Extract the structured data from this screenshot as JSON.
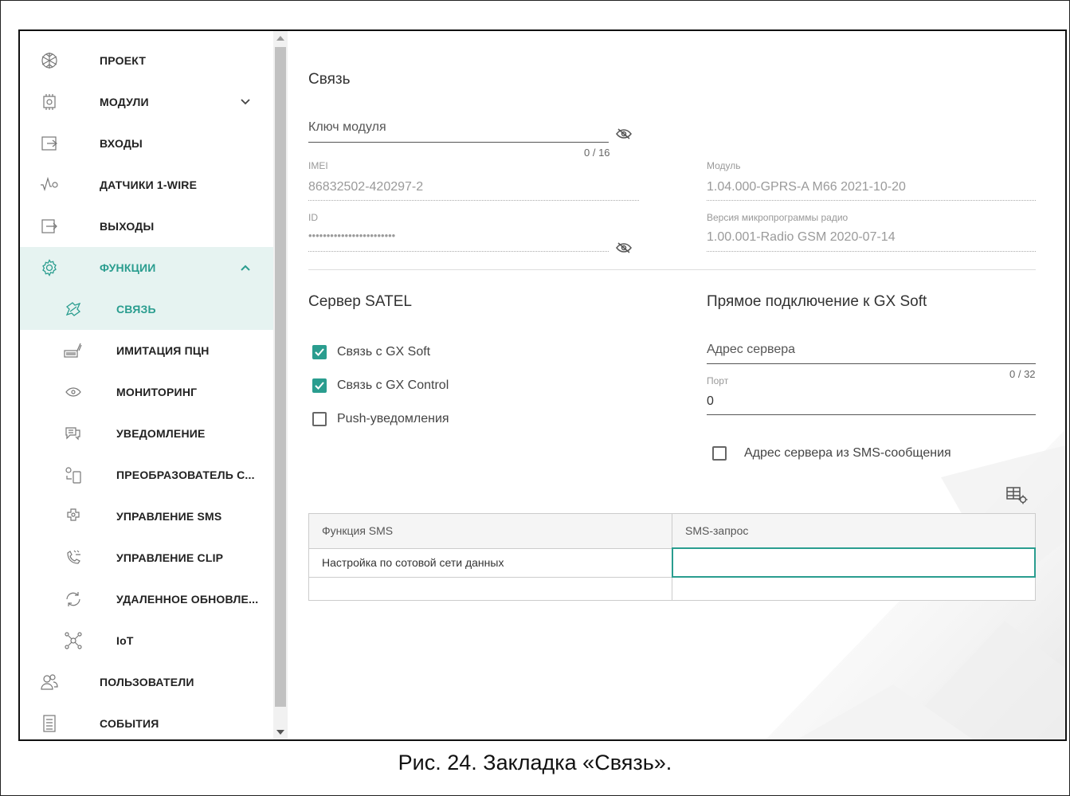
{
  "sidebar": {
    "items": [
      {
        "label": "ПРОЕКТ",
        "icon": "project-icon"
      },
      {
        "label": "МОДУЛИ",
        "icon": "module-chip-icon"
      },
      {
        "label": "ВХОДЫ",
        "icon": "inputs-icon"
      },
      {
        "label": "ДАТЧИКИ 1-WIRE",
        "icon": "sensor-wave-icon"
      },
      {
        "label": "ВЫХОДЫ",
        "icon": "outputs-icon"
      },
      {
        "label": "ФУНКЦИИ",
        "icon": "gear-icon"
      },
      {
        "label": "СВЯЗЬ",
        "icon": "communication-icon"
      },
      {
        "label": "ИМИТАЦИЯ ПЦН",
        "icon": "monitoring-station-icon"
      },
      {
        "label": "МОНИТОРИНГ",
        "icon": "eye-icon"
      },
      {
        "label": "УВЕДОМЛЕНИЕ",
        "icon": "message-bubble-icon"
      },
      {
        "label": "ПРЕОБРАЗОВАТЕЛЬ С...",
        "icon": "phone-converter-icon"
      },
      {
        "label": "УПРАВЛЕНИЕ SMS",
        "icon": "sms-control-icon"
      },
      {
        "label": "УПРАВЛЕНИЕ CLIP",
        "icon": "clip-phone-icon"
      },
      {
        "label": "УДАЛЕННОЕ ОБНОВЛЕ...",
        "icon": "remote-update-icon"
      },
      {
        "label": "IoT",
        "icon": "iot-network-icon"
      },
      {
        "label": "ПОЛЬЗОВАТЕЛИ",
        "icon": "users-icon"
      },
      {
        "label": "СОБЫТИЯ",
        "icon": "events-list-icon"
      }
    ]
  },
  "main": {
    "section_title": "Связь",
    "module_key": {
      "label": "Ключ модуля",
      "counter": "0 / 16"
    },
    "imei": {
      "label": "IMEI",
      "value": "86832502-420297-2"
    },
    "id": {
      "label": "ID",
      "value": "••••••••••••••••••••••••"
    },
    "module": {
      "label": "Модуль",
      "value": "1.04.000-GPRS-A M66 2021-10-20"
    },
    "radio_fw": {
      "label": "Версия микропрограммы радио",
      "value": "1.00.001-Radio GSM 2020-07-14"
    },
    "satel": {
      "title": "Сервер SATEL",
      "options": [
        {
          "label": "Связь с GX Soft",
          "checked": true
        },
        {
          "label": "Связь с GX Control",
          "checked": true
        },
        {
          "label": "Push-уведомления",
          "checked": false
        }
      ]
    },
    "direct": {
      "title": "Прямое подключение к GX Soft",
      "server_address": {
        "label": "Адрес сервера",
        "counter": "0 / 32"
      },
      "port": {
        "label": "Порт",
        "value": "0"
      },
      "sms_address": {
        "label": "Адрес сервера из SMS-сообщения",
        "checked": false
      }
    },
    "sms_table": {
      "columns": [
        "Функция SMS",
        "SMS-запрос"
      ],
      "rows": [
        [
          "Настройка по сотовой сети данных",
          ""
        ]
      ]
    }
  },
  "caption": "Рис. 24. Закладка «Связь».",
  "colors": {
    "accent": "#2a9d8f",
    "active_bg": "#e6f3f1"
  }
}
